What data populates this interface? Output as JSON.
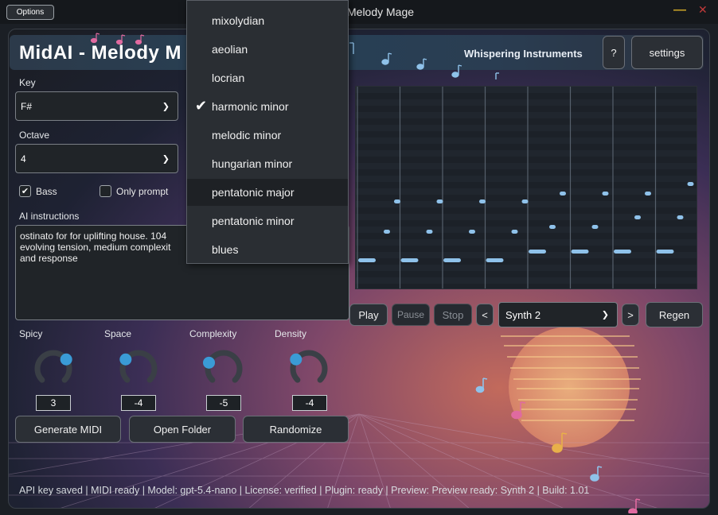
{
  "window": {
    "title": "Melody Mage",
    "options_label": "Options",
    "minimize_glyph": "—",
    "close_glyph": "✕"
  },
  "header": {
    "app_title": "MidAI - Melody M",
    "brand": "Whispering Instruments",
    "help_label": "?",
    "settings_label": "settings"
  },
  "controls": {
    "key_label": "Key",
    "key_value": "F#",
    "octave_label": "Octave",
    "octave_value": "4",
    "bass_label": "Bass",
    "bass_checked": true,
    "only_prompt_label": "Only prompt",
    "only_prompt_checked": false,
    "ai_label": "AI instructions",
    "ai_text_lines": [
      "ostinato for for uplifting house. 104",
      "evolving tension, medium complexit",
      "and response"
    ]
  },
  "knobs": [
    {
      "label": "Spicy",
      "value": "3",
      "level": 0.7
    },
    {
      "label": "Space",
      "value": "-4",
      "level": 0.3
    },
    {
      "label": "Complexity",
      "value": "-5",
      "level": 0.25
    },
    {
      "label": "Density",
      "value": "-4",
      "level": 0.3
    }
  ],
  "actions": {
    "generate": "Generate MIDI",
    "open_folder": "Open Folder",
    "randomize": "Randomize"
  },
  "transport": {
    "play": "Play",
    "pause": "Pause",
    "stop": "Stop",
    "prev": "<",
    "next": ">",
    "synth": "Synth 2",
    "regen": "Regen"
  },
  "scale_menu": {
    "items": [
      "mixolydian",
      "aeolian",
      "locrian",
      "harmonic minor",
      "melodic minor",
      "hungarian minor",
      "pentatonic major",
      "pentatonic minor",
      "blues"
    ],
    "selected_index": 3,
    "hover_index": 6
  },
  "status_bar": "API key saved | MIDI ready | Model: gpt-5.4-nano | License: verified | Plugin: ready | Preview: Preview ready: Synth 2 | Build: 1.01",
  "colors": {
    "accent_blue": "#3a9bd6",
    "note_blue": "#8fc2ea",
    "pink_note": "#e06aa0",
    "yellow_note": "#e8b04a",
    "sun": "#e8a36a"
  }
}
